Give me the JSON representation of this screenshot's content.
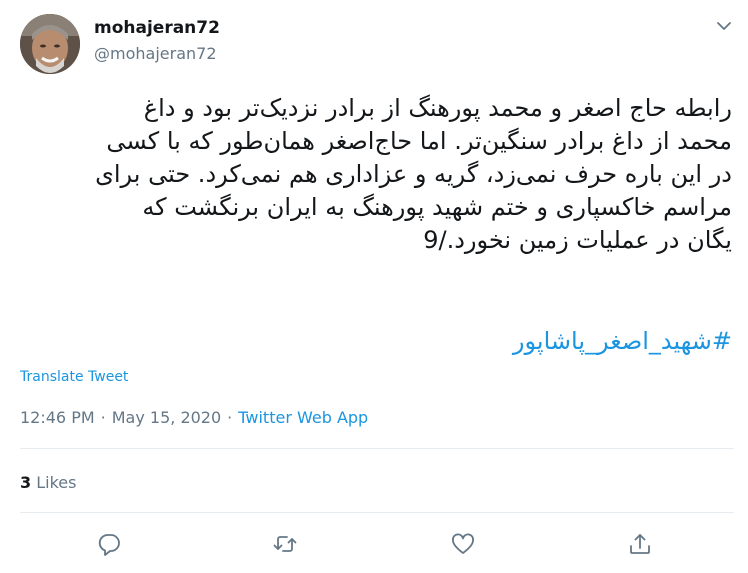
{
  "author": {
    "display_name": "mohajeran72",
    "handle": "@mohajeran72"
  },
  "tweet": {
    "lines": [
      "رابطه حاج اصغر و محمد پورهنگ از برادر نزدیک‌تر بود و داغ",
      "محمد از داغ برادر سنگین‌تر. اما حاج‌اصغر همان‌طور که با کسی",
      "در این باره حرف نمی‌زد، گریه و عزاداری هم نمی‌کرد. حتی برای",
      "مراسم خاکسپاری و ختم شهید پورهنگ به ایران برنگشت که",
      "یگان در عملیات زمین نخورد./9"
    ],
    "hashtag": "#شهید_اصغر_پاشاپور"
  },
  "translate_label": "Translate Tweet",
  "meta": {
    "time": "12:46 PM",
    "separator": "·",
    "date": "May 15, 2020",
    "source": "Twitter Web App"
  },
  "likes": {
    "count": "3",
    "label": "Likes"
  },
  "icons": {
    "menu": "chevron-down-icon",
    "reply": "reply-icon",
    "retweet": "retweet-icon",
    "like": "heart-icon",
    "share": "share-icon"
  },
  "colors": {
    "link": "#1b95e0",
    "muted": "#657786",
    "text": "#14171a",
    "divider": "#e6ecf0"
  }
}
